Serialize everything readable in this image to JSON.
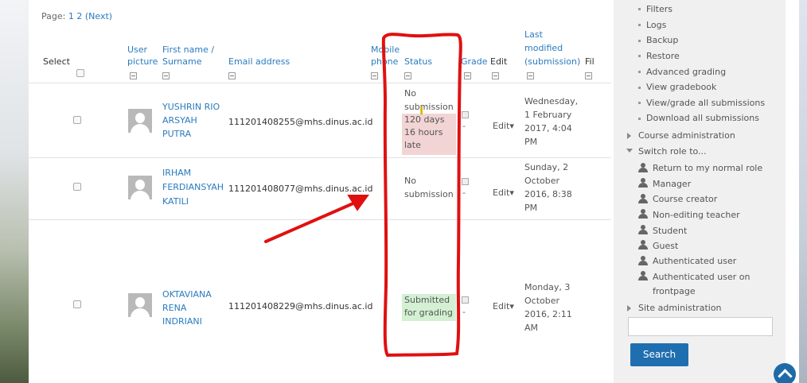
{
  "pager": {
    "label": "Page:",
    "p1": "1",
    "p2": "2",
    "next": "(Next)"
  },
  "headers": {
    "select": "Select",
    "user_picture": [
      "User",
      "picture"
    ],
    "name": [
      "First name /",
      "Surname"
    ],
    "email": "Email address",
    "mobile": [
      "Mobile",
      "phone"
    ],
    "status": "Status",
    "grade": "Grade",
    "edit": "Edit",
    "last_modified": [
      "Last",
      "modified",
      "(submission)"
    ],
    "file": "Fil"
  },
  "rows": [
    {
      "name": [
        "YUSHRIN RIO",
        "ARSYAH",
        "PUTRA"
      ],
      "email": "111201408255@mhs.dinus.ac.id",
      "status": [
        "No",
        "submission"
      ],
      "status_extra": [
        "120 days",
        "16 hours",
        "late"
      ],
      "grade": "-",
      "edit": "Edit",
      "date": [
        "Wednesday,",
        "1 February",
        "2017, 4:04",
        "PM"
      ]
    },
    {
      "name": [
        "IRHAM",
        "FERDIANSYAH",
        "KATILI"
      ],
      "email": "111201408077@mhs.dinus.ac.id",
      "status": [
        "No",
        "submission"
      ],
      "grade": "-",
      "edit": "Edit",
      "date": [
        "Sunday, 2",
        "October",
        "2016, 8:38",
        "PM"
      ]
    },
    {
      "name": [
        "OKTAVIANA",
        "RENA",
        "INDRIANI"
      ],
      "email": "111201408229@mhs.dinus.ac.id",
      "status": [
        "Submitted",
        "for grading"
      ],
      "grade": "-",
      "edit": "Edit",
      "date": [
        "Monday, 3",
        "October",
        "2016, 2:11",
        "AM"
      ]
    }
  ],
  "sidebar": {
    "admin_items": [
      "Filters",
      "Logs",
      "Backup",
      "Restore",
      "Advanced grading",
      "View gradebook",
      "View/grade all submissions",
      "Download all submissions"
    ],
    "course_admin": "Course administration",
    "switch_role": "Switch role to...",
    "roles": [
      "Return to my normal role",
      "Manager",
      "Course creator",
      "Non-editing teacher",
      "Student",
      "Guest",
      "Authenticated user",
      "Authenticated user on",
      "frontpage"
    ],
    "site_admin": "Site administration",
    "search_button": "Search"
  },
  "colors": {
    "link": "#2a7bbf",
    "late_bg": "#f2d4d4",
    "submitted_bg": "#d3f0d3",
    "annotation": "#e01010",
    "button": "#1f6fb0"
  }
}
